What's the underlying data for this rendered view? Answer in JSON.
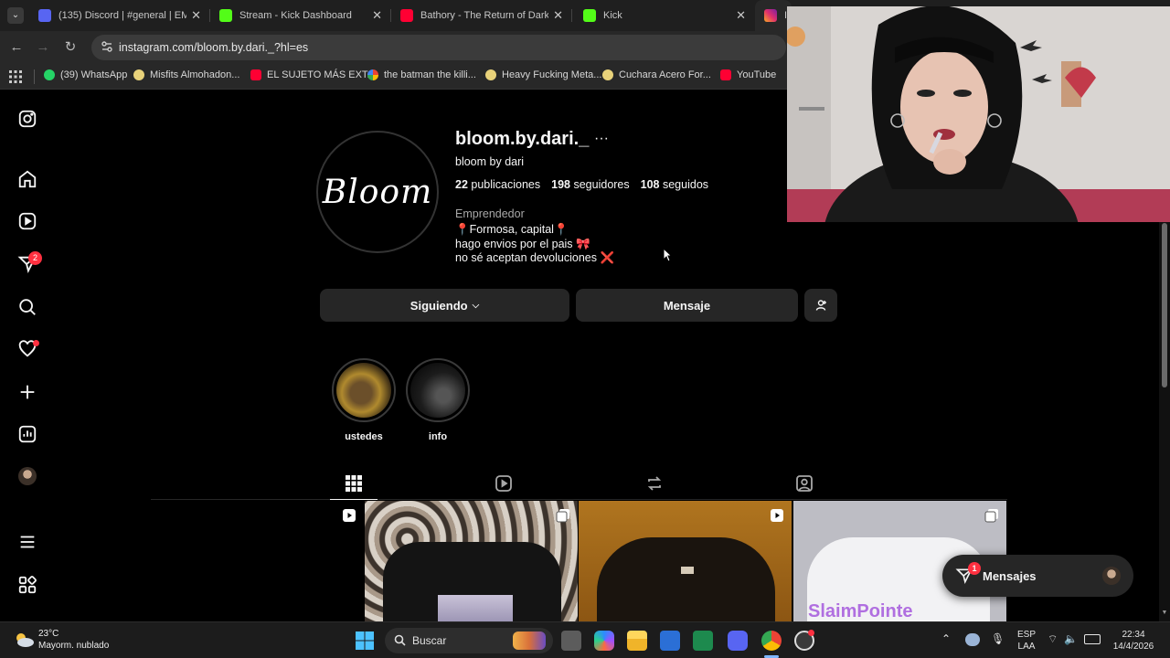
{
  "browser": {
    "tabs": [
      {
        "title": "(135) Discord | #general | EMO...",
        "icon_color": "#5865f2",
        "badge": "135"
      },
      {
        "title": "Stream - Kick Dashboard",
        "icon_color": "#53fc18"
      },
      {
        "title": "Bathory - The Return of Darkne...",
        "icon_color": "#ff0033"
      },
      {
        "title": "Kick",
        "icon_color": "#53fc18"
      },
      {
        "title": "In",
        "icon_color": "#e1306c"
      }
    ],
    "url": "instagram.com/bloom.by.dari._?hl=es",
    "bookmarks": [
      {
        "label": "(39) WhatsApp",
        "icon_color": "#25d366",
        "badge": "6"
      },
      {
        "label": "Misfits Almohadon...",
        "icon_color": "#e8d27a"
      },
      {
        "label": "EL SUJETO MÁS EXT...",
        "icon_color": "#ff0033"
      },
      {
        "label": "the batman the killi...",
        "icon_color": "#4285f4"
      },
      {
        "label": "Heavy Fucking Meta...",
        "icon_color": "#e8d27a"
      },
      {
        "label": "Cuchara Acero For...",
        "icon_color": "#e8d27a"
      },
      {
        "label": "YouTube",
        "icon_color": "#ff0033"
      }
    ]
  },
  "instagram": {
    "sidebar": {
      "notifications_badge": "2",
      "icons": [
        "instagram-logo-icon",
        "home-icon",
        "reels-icon",
        "messages-icon",
        "search-icon",
        "heart-icon",
        "create-icon",
        "dashboard-icon",
        "profile-avatar",
        "menu-icon",
        "more-apps-icon"
      ]
    },
    "profile": {
      "avatar_text": "Bloom",
      "username": "bloom.by.dari._",
      "more": "···",
      "full_name": "bloom by dari",
      "stats": [
        {
          "count": "22",
          "label": "publicaciones"
        },
        {
          "count": "198",
          "label": "seguidores"
        },
        {
          "count": "108",
          "label": "seguidos"
        }
      ],
      "category": "Emprendedor",
      "bio": [
        "📍Formosa, capital📍",
        "hago envios por el pais 🎀",
        "no sé aceptan devoluciones ❌"
      ]
    },
    "actions": {
      "following": "Siguiendo",
      "message": "Mensaje"
    },
    "highlights": [
      {
        "label": "ustedes"
      },
      {
        "label": "info"
      }
    ],
    "posts": [
      {
        "type": "reel"
      },
      {
        "type": "carousel"
      },
      {
        "type": "reel"
      },
      {
        "type": "carousel",
        "caption": "SlaimPointe"
      }
    ],
    "messages_pill": {
      "label": "Mensajes",
      "badge": "1"
    }
  },
  "taskbar": {
    "weather_temp": "23°C",
    "weather_desc": "Mayorm. nublado",
    "search_label": "Buscar",
    "lang_top": "ESP",
    "lang_bottom": "LAA",
    "time": "22:34",
    "date": "14/4/2026"
  }
}
